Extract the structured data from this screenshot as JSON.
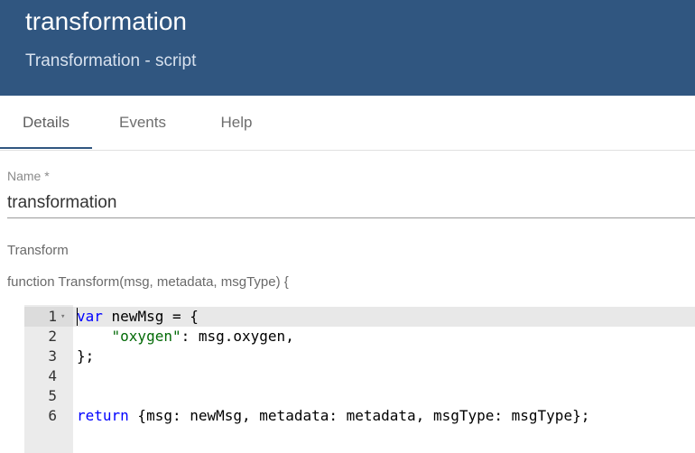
{
  "header": {
    "title": "transformation",
    "subtitle": "Transformation - script"
  },
  "tabs": [
    {
      "label": "Details",
      "active": true
    },
    {
      "label": "Events",
      "active": false
    },
    {
      "label": "Help",
      "active": false
    }
  ],
  "form": {
    "name_label": "Name *",
    "name_value": "transformation",
    "transform_label": "Transform",
    "function_signature": "function Transform(msg, metadata, msgType) {"
  },
  "editor": {
    "active_line": 1,
    "lines": [
      {
        "number": "1",
        "tokens": [
          {
            "t": "kw",
            "v": "var"
          },
          {
            "t": "plain",
            "v": " newMsg = {"
          }
        ]
      },
      {
        "number": "2",
        "tokens": [
          {
            "t": "plain",
            "v": "    "
          },
          {
            "t": "str",
            "v": "\"oxygen\""
          },
          {
            "t": "plain",
            "v": ": msg.oxygen,"
          }
        ]
      },
      {
        "number": "3",
        "tokens": [
          {
            "t": "plain",
            "v": "};"
          }
        ]
      },
      {
        "number": "4",
        "tokens": []
      },
      {
        "number": "5",
        "tokens": []
      },
      {
        "number": "6",
        "tokens": [
          {
            "t": "kw",
            "v": "return"
          },
          {
            "t": "plain",
            "v": " {msg: newMsg, metadata: metadata, msgType: msgType};"
          }
        ]
      }
    ]
  },
  "colors": {
    "header_bg": "#305680",
    "keyword": "#0000ff",
    "string": "#036a07",
    "tab_indicator": "#305680"
  }
}
